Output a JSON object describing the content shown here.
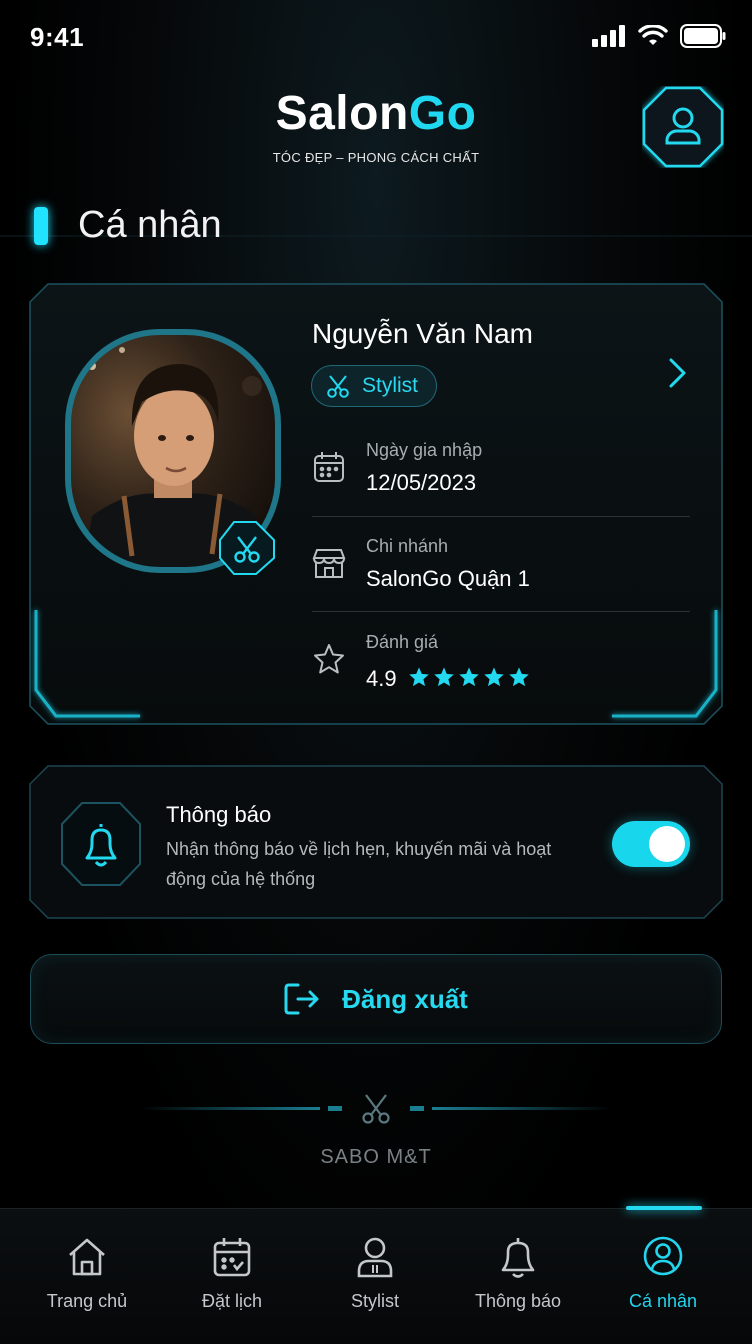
{
  "status_bar": {
    "time": "9:41"
  },
  "header": {
    "logo_part1": "Salon",
    "logo_part2": "Go",
    "tagline": "TÓC ĐẸP – PHONG CÁCH CHẤT",
    "profile_icon": "user-icon"
  },
  "page_title": "Cá nhân",
  "profile": {
    "name": "Nguyễn Văn Nam",
    "role": "Stylist",
    "join_label": "Ngày gia nhập",
    "join_date": "12/05/2023",
    "branch_label": "Chi nhánh",
    "branch": "SalonGo Quận 1",
    "rating_label": "Đánh giá",
    "rating": "4.9",
    "stars_filled": 5
  },
  "notifications": {
    "title": "Thông báo",
    "description": "Nhận thông báo về lịch hẹn, khuyến mãi và hoạt động của hệ thống",
    "enabled": true
  },
  "logout_label": "Đăng xuất",
  "footer_brand": "SABO M&T",
  "nav": [
    {
      "label": "Trang chủ",
      "icon": "home-icon"
    },
    {
      "label": "Đặt lịch",
      "icon": "calendar-icon"
    },
    {
      "label": "Stylist",
      "icon": "stylist-icon"
    },
    {
      "label": "Thông báo",
      "icon": "bell-icon"
    },
    {
      "label": "Cá nhân",
      "icon": "user-icon",
      "active": true
    }
  ],
  "colors": {
    "accent": "#22D9F0",
    "background": "#000000",
    "card_border": "#1C5360"
  }
}
